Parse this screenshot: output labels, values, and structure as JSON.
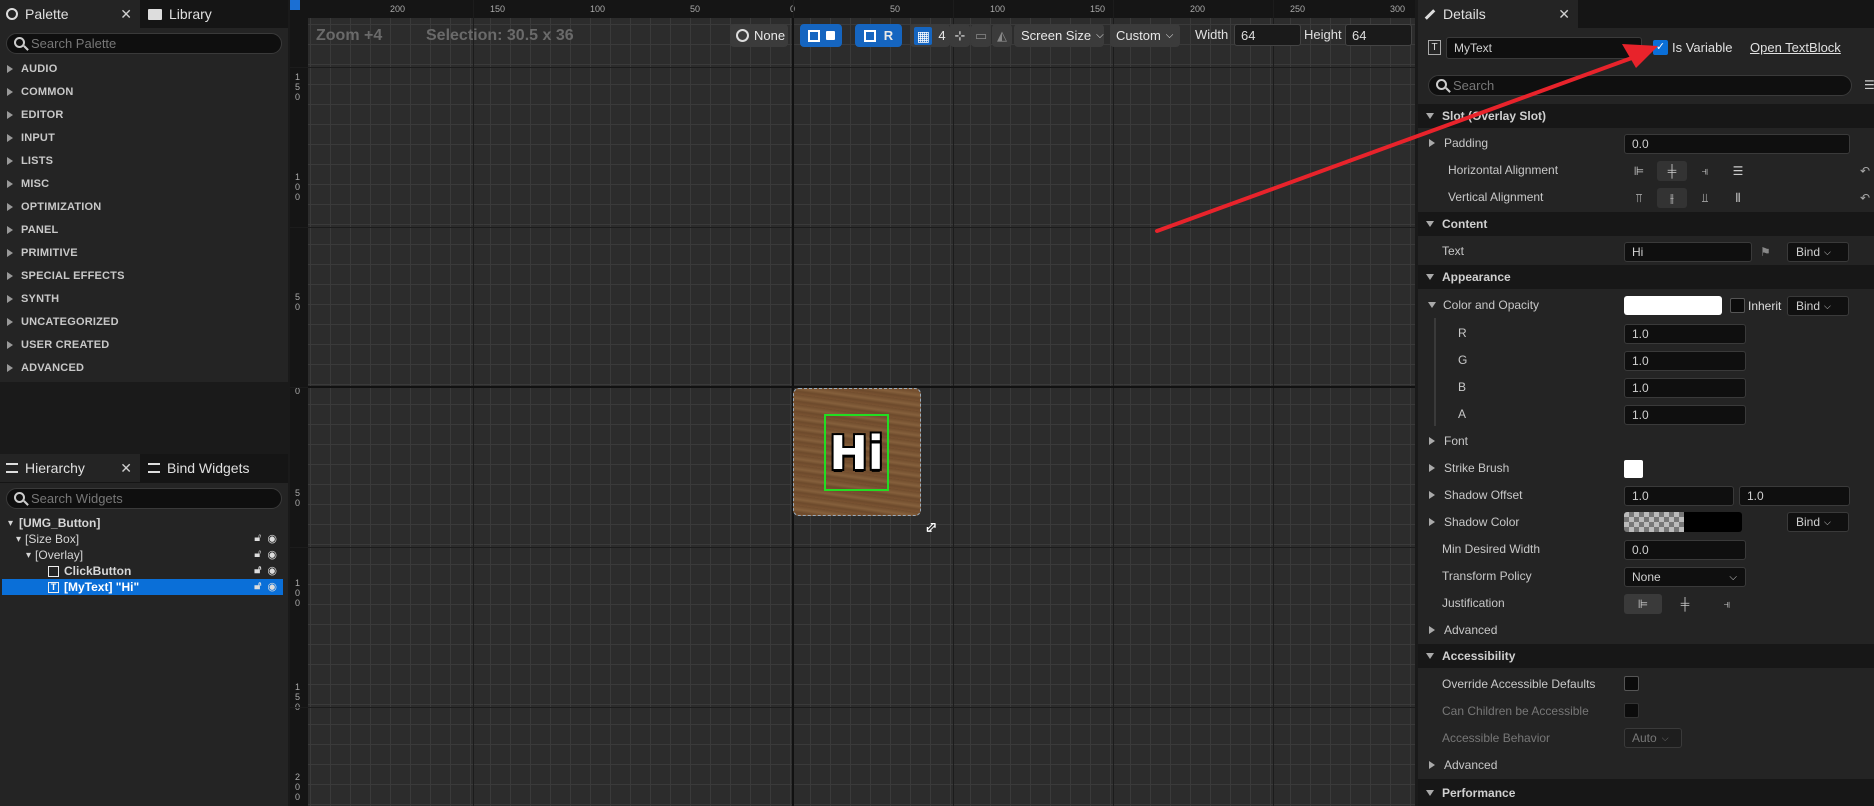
{
  "palette": {
    "tab_label": "Palette",
    "library_tab_label": "Library",
    "search_placeholder": "Search Palette",
    "categories": [
      "AUDIO",
      "COMMON",
      "EDITOR",
      "INPUT",
      "LISTS",
      "MISC",
      "OPTIMIZATION",
      "PANEL",
      "PRIMITIVE",
      "SPECIAL EFFECTS",
      "SYNTH",
      "UNCATEGORIZED",
      "USER CREATED",
      "ADVANCED"
    ]
  },
  "hierarchy": {
    "tab_label": "Hierarchy",
    "bind_widgets_label": "Bind Widgets",
    "search_placeholder": "Search Widgets",
    "items": [
      {
        "label": "[UMG_Button]"
      },
      {
        "label": "[Size Box]"
      },
      {
        "label": "[Overlay]"
      },
      {
        "label": "ClickButton"
      },
      {
        "label": "[MyText] \"Hi\""
      }
    ]
  },
  "canvas": {
    "zoom_label": "Zoom +4",
    "selection_label": "Selection: 30.5 x 36",
    "ruler_top": [
      "200",
      "150",
      "100",
      "50",
      "0",
      "50",
      "100",
      "150",
      "200",
      "250",
      "300"
    ],
    "ruler_left": [
      "1\n5\n0",
      "1\n0\n0",
      "5\n0",
      "0",
      "5\n0",
      "1\n0\n0",
      "1\n5\n0",
      "2\n0\n0"
    ],
    "toolbar": {
      "none_label": "None",
      "r_label": "R",
      "grid_label": "4",
      "screen_size_label": "Screen Size",
      "custom_label": "Custom",
      "width_label": "Width",
      "width_value": "64",
      "height_label": "Height",
      "height_value": "64"
    },
    "widget_text": "Hi"
  },
  "details": {
    "tab_label": "Details",
    "name_value": "MyText",
    "is_variable_label": "Is Variable",
    "open_textblock_label": "Open TextBlock",
    "search_placeholder": "Search",
    "sections": {
      "slot": "Slot (Overlay Slot)",
      "content": "Content",
      "appearance": "Appearance",
      "accessibility": "Accessibility",
      "performance": "Performance"
    },
    "props": {
      "padding": "Padding",
      "padding_value": "0.0",
      "halign": "Horizontal Alignment",
      "valign": "Vertical Alignment",
      "text": "Text",
      "text_value": "Hi",
      "bind": "Bind",
      "color_opacity": "Color and Opacity",
      "inherit": "Inherit",
      "r": "R",
      "r_value": "1.0",
      "g": "G",
      "g_value": "1.0",
      "b": "B",
      "b_value": "1.0",
      "a": "A",
      "a_value": "1.0",
      "font": "Font",
      "strike_brush": "Strike Brush",
      "shadow_offset": "Shadow Offset",
      "shadow_offset_x": "1.0",
      "shadow_offset_y": "1.0",
      "shadow_color": "Shadow Color",
      "min_desired_width": "Min Desired Width",
      "min_desired_width_value": "0.0",
      "transform_policy": "Transform Policy",
      "transform_policy_value": "None",
      "justification": "Justification",
      "advanced": "Advanced",
      "override_accessible": "Override Accessible Defaults",
      "can_children": "Can Children be Accessible",
      "accessible_behavior": "Accessible Behavior",
      "accessible_behavior_value": "Auto",
      "advanced2": "Advanced"
    }
  },
  "colors": {
    "accent": "#0a6fd8",
    "annotation_arrow": "#e8232b",
    "selection_outline": "#22dd22"
  }
}
